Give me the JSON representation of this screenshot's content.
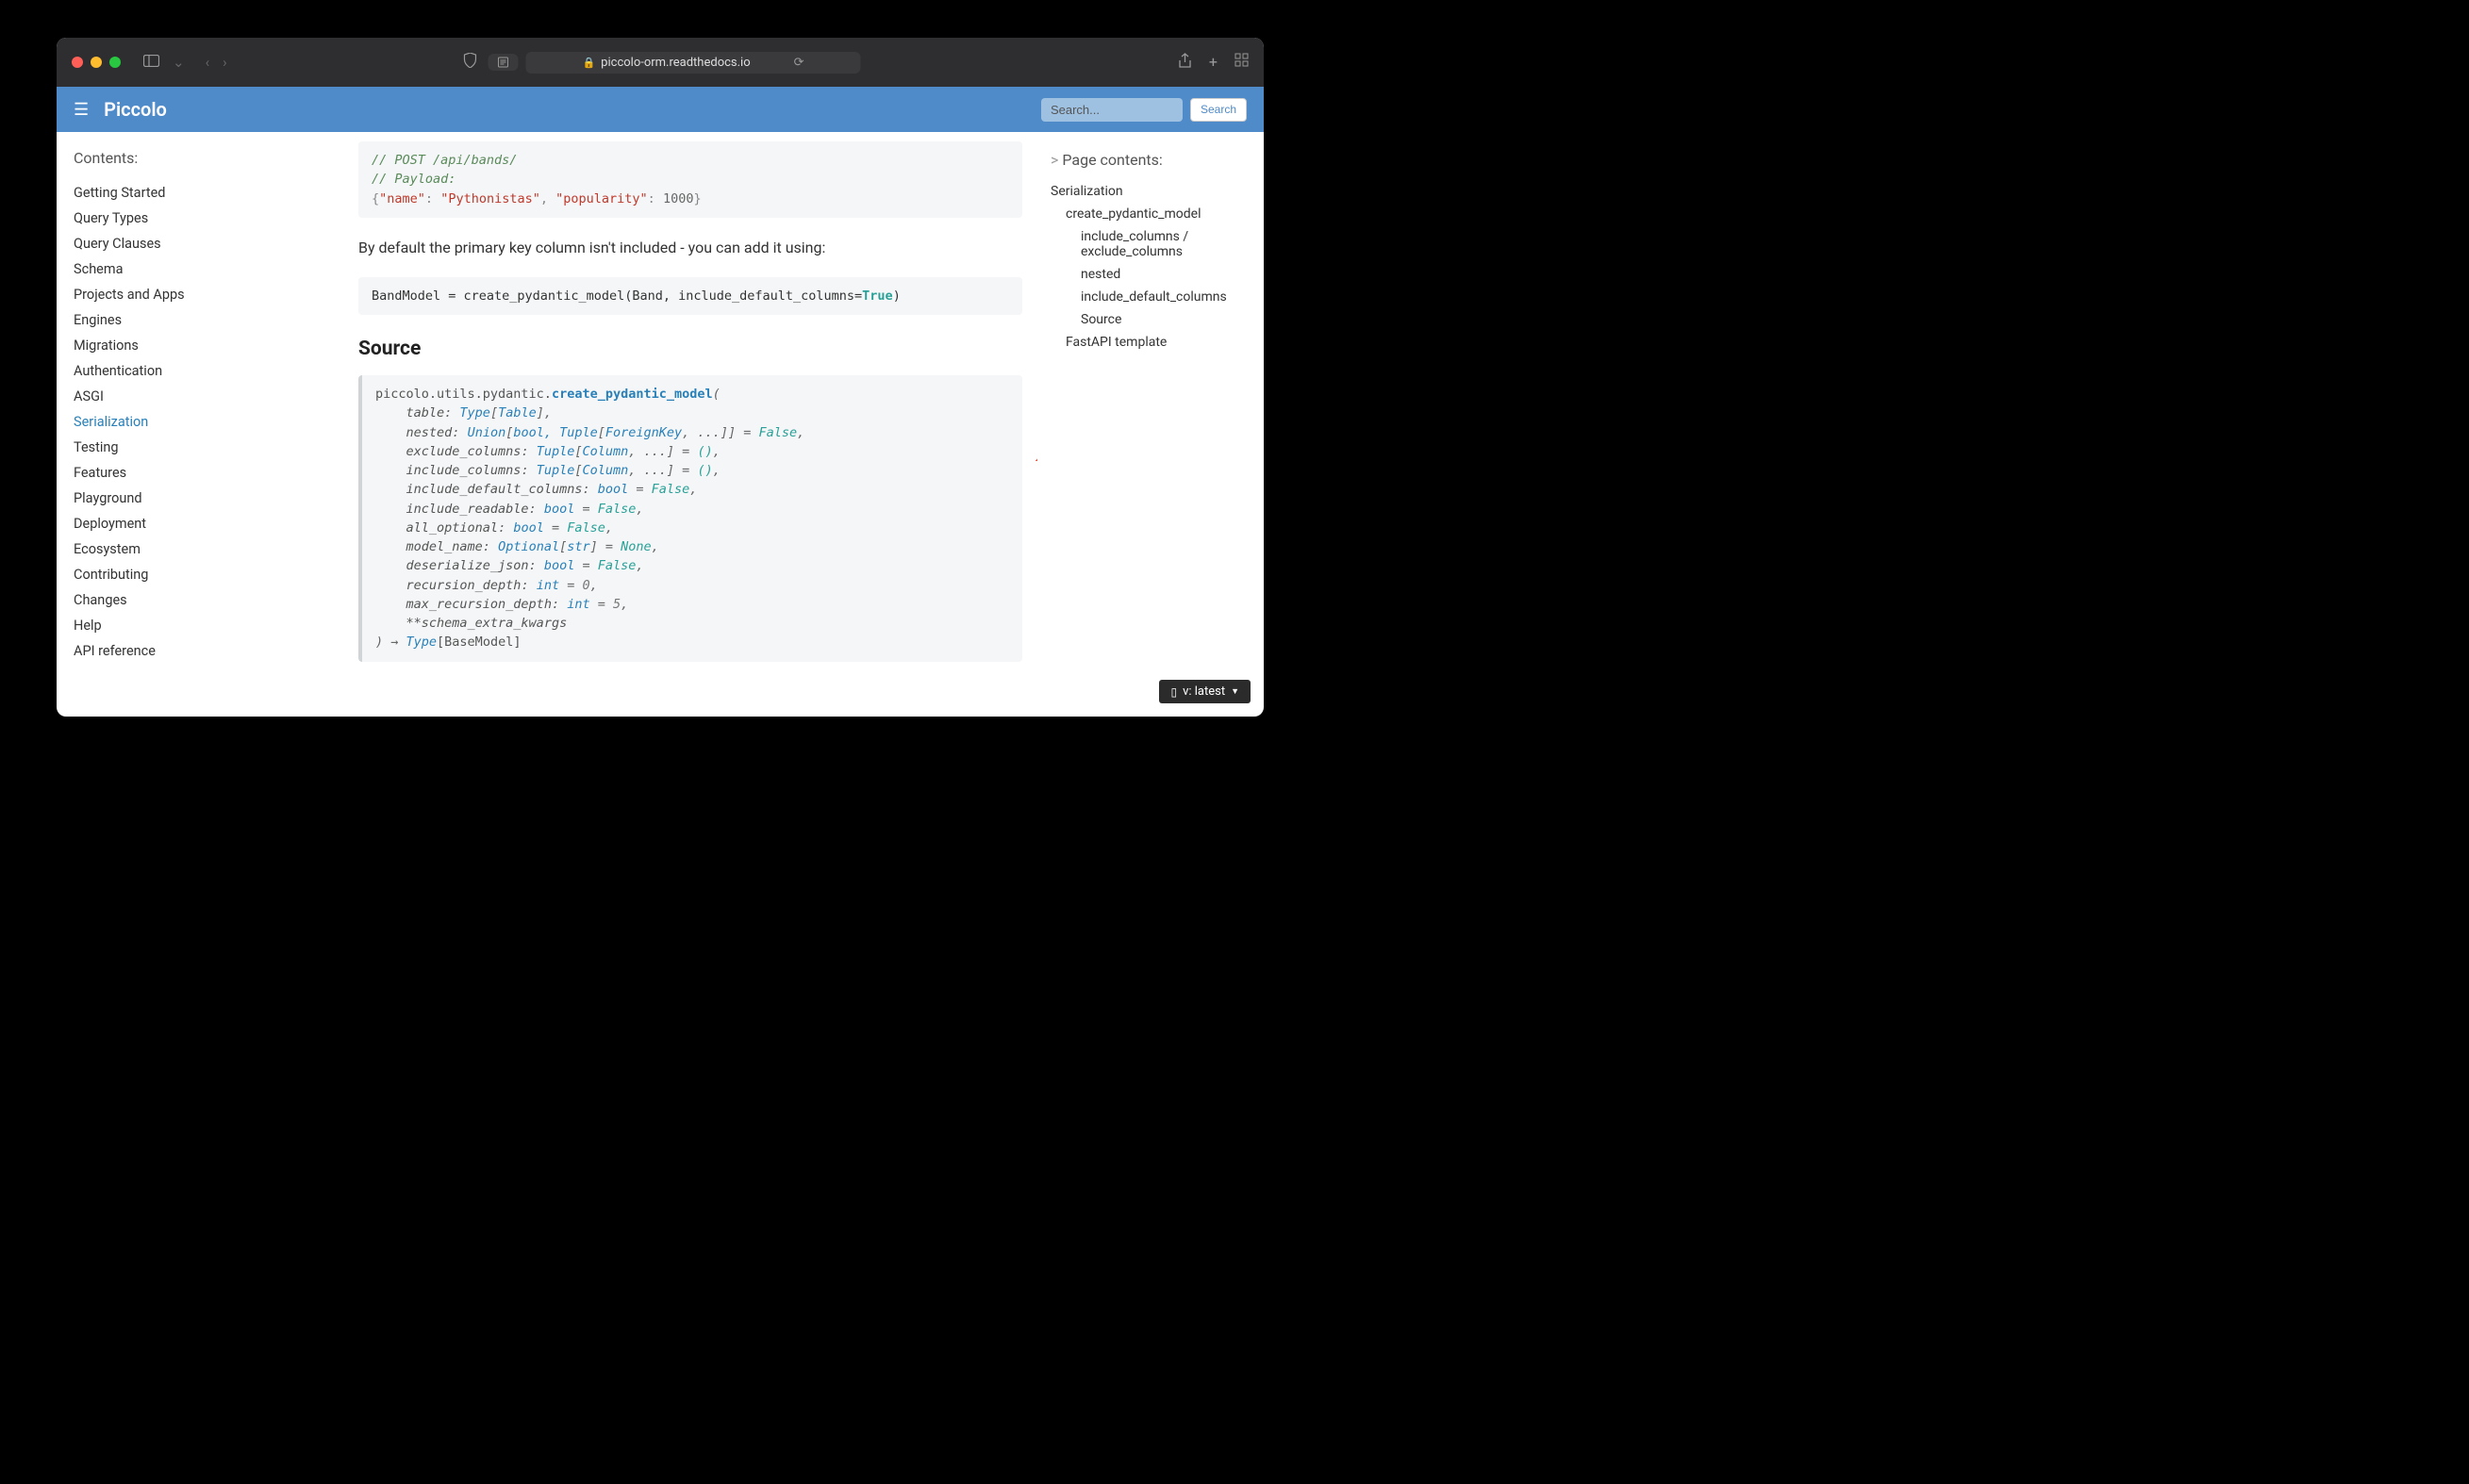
{
  "browser": {
    "url_host": "piccolo-orm.readthedocs.io"
  },
  "header": {
    "brand": "Piccolo",
    "search_placeholder": "Search...",
    "search_button": "Search"
  },
  "sidebar_left": {
    "title": "Contents:",
    "items": [
      {
        "label": "Getting Started",
        "active": false
      },
      {
        "label": "Query Types",
        "active": false
      },
      {
        "label": "Query Clauses",
        "active": false
      },
      {
        "label": "Schema",
        "active": false
      },
      {
        "label": "Projects and Apps",
        "active": false
      },
      {
        "label": "Engines",
        "active": false
      },
      {
        "label": "Migrations",
        "active": false
      },
      {
        "label": "Authentication",
        "active": false
      },
      {
        "label": "ASGI",
        "active": false
      },
      {
        "label": "Serialization",
        "active": true
      },
      {
        "label": "Testing",
        "active": false
      },
      {
        "label": "Features",
        "active": false
      },
      {
        "label": "Playground",
        "active": false
      },
      {
        "label": "Deployment",
        "active": false
      },
      {
        "label": "Ecosystem",
        "active": false
      },
      {
        "label": "Contributing",
        "active": false
      },
      {
        "label": "Changes",
        "active": false
      },
      {
        "label": "Help",
        "active": false
      },
      {
        "label": "API reference",
        "active": false
      }
    ]
  },
  "main": {
    "code1": {
      "comment1": "// POST /api/bands/",
      "comment2": "// Payload:",
      "json_open": "{",
      "key1": "\"name\"",
      "val1": "\"Pythonistas\"",
      "key2": "\"popularity\"",
      "val2": "1000",
      "json_close": "}"
    },
    "paragraph": "By default the primary key column isn't included - you can add it using:",
    "code2": {
      "line": "BandModel = create_pydantic_model(Band, include_default_columns=",
      "true": "True",
      "end": ")"
    },
    "section_heading": "Source",
    "signature": {
      "module": "piccolo.utils.pydantic.",
      "function": "create_pydantic_model",
      "open": "(",
      "params": [
        {
          "name": "table",
          "type_pre": "Type",
          "type_bracket": "[",
          "type_inner": "Table",
          "type_close": "]",
          "default": null
        },
        {
          "name": "nested",
          "type_raw": "Union[bool, Tuple[ForeignKey, ...]]",
          "default": "False"
        },
        {
          "name": "exclude_columns",
          "type_raw": "Tuple[Column, ...]",
          "default": "()"
        },
        {
          "name": "include_columns",
          "type_raw": "Tuple[Column, ...]",
          "default": "()"
        },
        {
          "name": "include_default_columns",
          "type_raw": "bool",
          "default": "False"
        },
        {
          "name": "include_readable",
          "type_raw": "bool",
          "default": "False"
        },
        {
          "name": "all_optional",
          "type_raw": "bool",
          "default": "False"
        },
        {
          "name": "model_name",
          "type_raw": "Optional[str]",
          "default": "None"
        },
        {
          "name": "deserialize_json",
          "type_raw": "bool",
          "default": "False"
        },
        {
          "name": "recursion_depth",
          "type_raw": "int",
          "default_num": "0"
        },
        {
          "name": "max_recursion_depth",
          "type_raw": "int",
          "default_num": "5"
        },
        {
          "name": "**schema_extra_kwargs",
          "type_raw": null,
          "default": null
        }
      ],
      "close": ")",
      "arrow": " → ",
      "return_type": "Type",
      "return_inner": "[BaseModel]"
    }
  },
  "sidebar_right": {
    "title": "Page contents:",
    "items": [
      {
        "label": "Serialization",
        "level": 1
      },
      {
        "label": "create_pydantic_model",
        "level": 2
      },
      {
        "label": "include_columns / exclude_columns",
        "level": 3
      },
      {
        "label": "nested",
        "level": 3
      },
      {
        "label": "include_default_columns",
        "level": 3
      },
      {
        "label": "Source",
        "level": 3
      },
      {
        "label": "FastAPI template",
        "level": 2
      }
    ]
  },
  "version": "v: latest"
}
